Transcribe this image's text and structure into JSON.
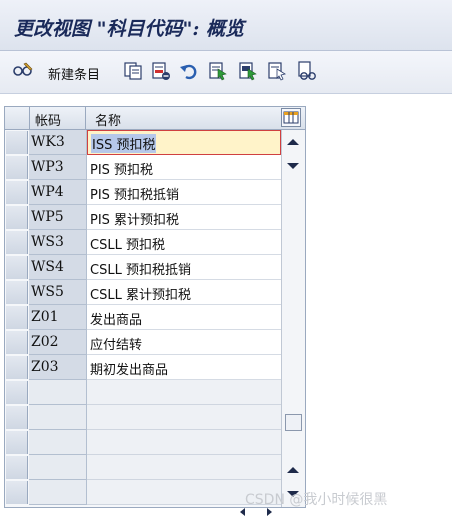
{
  "window": {
    "title": "更改视图 \"科目代码\": 概览"
  },
  "toolbar": {
    "new_entries_label": "新建条目",
    "icons": [
      "glasses-edit-icon",
      "copy-icon",
      "delete-icon",
      "undo-icon",
      "select-all-icon",
      "select-block-icon",
      "deselect-all-icon",
      "print-preview-icon"
    ]
  },
  "table": {
    "columns": [
      "帐码",
      "名称"
    ],
    "rows": [
      {
        "code": "WK3",
        "name": "ISS 预扣税"
      },
      {
        "code": "WP3",
        "name": "PIS 预扣税"
      },
      {
        "code": "WP4",
        "name": "PIS 预扣税抵销"
      },
      {
        "code": "WP5",
        "name": "PIS 累计预扣税"
      },
      {
        "code": "WS3",
        "name": "CSLL 预扣税"
      },
      {
        "code": "WS4",
        "name": "CSLL 预扣税抵销"
      },
      {
        "code": "WS5",
        "name": "CSLL 累计预扣税"
      },
      {
        "code": "Z01",
        "name": "发出商品"
      },
      {
        "code": "Z02",
        "name": "应付结转"
      },
      {
        "code": "Z03",
        "name": "期初发出商品"
      }
    ],
    "empty_rows": 5,
    "active_row": 0
  },
  "watermark": "CSDN @我小时候很黑",
  "colors": {
    "title": "#1a2a5a",
    "key_column": "#d4dbe6",
    "active_cell": "#fff3c9"
  }
}
